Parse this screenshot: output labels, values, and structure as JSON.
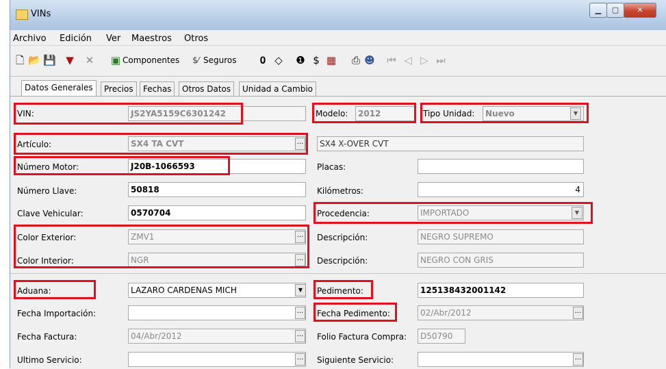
{
  "window": {
    "title": "VINs"
  },
  "menu": [
    "Archivo",
    "Edición",
    "Ver",
    "Maestros",
    "Otros"
  ],
  "toolbar": {
    "componentes": "Componentes",
    "seguros": "Seguros"
  },
  "tabs": [
    "Datos Generales",
    "Precios",
    "Fechas",
    "Otros Datos",
    "Unidad a Cambio"
  ],
  "form": {
    "vin": {
      "label": "VIN:",
      "value": "JS2YA5159C6301242"
    },
    "modelo": {
      "label": "Modelo:",
      "value": "2012"
    },
    "tipo_unidad": {
      "label": "Tipo Unidad:",
      "value": "Nuevo"
    },
    "articulo": {
      "label": "Artículo:",
      "value": "SX4 TA CVT",
      "description": "SX4 X-OVER CVT"
    },
    "numero_motor": {
      "label": "Número Motor:",
      "value": "J20B-1066593"
    },
    "placas": {
      "label": "Placas:",
      "value": ""
    },
    "numero_llave": {
      "label": "Número Llave:",
      "value": "50818"
    },
    "kilometros": {
      "label": "Kilómetros:",
      "value": "4"
    },
    "clave_vehicular": {
      "label": "Clave Vehicular:",
      "value": "0570704"
    },
    "procedencia": {
      "label": "Procedencia:",
      "value": "IMPORTADO"
    },
    "color_exterior": {
      "label": "Color Exterior:",
      "value": "ZMV1"
    },
    "descripcion_ext": {
      "label": "Descripción:",
      "value": "NEGRO SUPREMO"
    },
    "color_interior": {
      "label": "Color Interior:",
      "value": "NGR"
    },
    "descripcion_int": {
      "label": "Descripción:",
      "value": "NEGRO CON GRIS"
    },
    "aduana": {
      "label": "Aduana:",
      "value": "LAZARO CARDENAS MICH"
    },
    "pedimento": {
      "label": "Pedimento:",
      "value": "125138432001142"
    },
    "fecha_importacion": {
      "label": "Fecha Importación:",
      "value": ""
    },
    "fecha_pedimento": {
      "label": "Fecha Pedimento:",
      "value": "02/Abr/2012"
    },
    "fecha_factura": {
      "label": "Fecha Factura:",
      "value": "04/Abr/2012"
    },
    "folio_factura_compra": {
      "label": "Folio Factura Compra:",
      "value": "D50790"
    },
    "ultimo_servicio": {
      "label": "Ultimo Servicio:",
      "value": ""
    },
    "siguiente_servicio": {
      "label": "Siguiente Servicio:",
      "value": ""
    }
  },
  "colors": {
    "highlight": "#e0101c"
  }
}
